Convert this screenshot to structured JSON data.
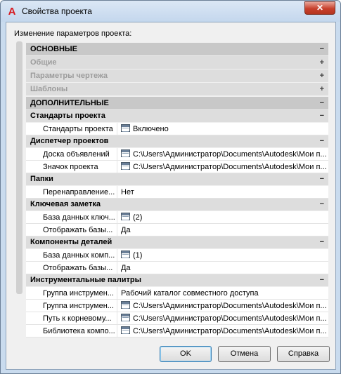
{
  "window": {
    "title": "Свойства проекта",
    "app_icon": "A",
    "close_glyph": "✕"
  },
  "subtitle": "Изменение параметров проекта:",
  "sections": {
    "basic": {
      "label": "ОСНОВНЫЕ",
      "toggle": "−"
    },
    "general": {
      "label": "Общие",
      "toggle": "+"
    },
    "drawing": {
      "label": "Параметры чертежа",
      "toggle": "+"
    },
    "templates": {
      "label": "Шаблоны",
      "toggle": "+"
    },
    "advanced": {
      "label": "ДОПОЛНИТЕЛЬНЫЕ",
      "toggle": "−"
    }
  },
  "groups": {
    "standards": {
      "label": "Стандарты проекта",
      "toggle": "−",
      "rows": [
        {
          "name": "Стандарты проекта",
          "value": "Включено",
          "icon": "table-icon"
        }
      ]
    },
    "manager": {
      "label": "Диспетчер проектов",
      "toggle": "−",
      "rows": [
        {
          "name": "Доска объявлений",
          "value": "C:\\Users\\Администратор\\Documents\\Autodesk\\Мои п...",
          "icon": "table-icon"
        },
        {
          "name": "Значок проекта",
          "value": "C:\\Users\\Администратор\\Documents\\Autodesk\\Мои п...",
          "icon": "table-icon"
        }
      ]
    },
    "folders": {
      "label": "Папки",
      "toggle": "−",
      "rows": [
        {
          "name": "Перенаправление...",
          "value": "Нет",
          "icon": ""
        }
      ]
    },
    "keynote": {
      "label": "Ключевая заметка",
      "toggle": "−",
      "rows": [
        {
          "name": "База данных ключ...",
          "value": "(2)",
          "icon": "table-icon"
        },
        {
          "name": "Отображать базы...",
          "value": "Да",
          "icon": ""
        }
      ]
    },
    "components": {
      "label": "Компоненты деталей",
      "toggle": "−",
      "rows": [
        {
          "name": "База данных комп...",
          "value": "(1)",
          "icon": "table-icon"
        },
        {
          "name": "Отображать базы...",
          "value": "Да",
          "icon": ""
        }
      ]
    },
    "palettes": {
      "label": "Инструментальные палитры",
      "toggle": "−",
      "rows": [
        {
          "name": "Группа инструмен...",
          "value": "Рабочий каталог совместного доступа",
          "icon": ""
        },
        {
          "name": "Группа инструмен...",
          "value": "C:\\Users\\Администратор\\Documents\\Autodesk\\Мои п...",
          "icon": "table-icon"
        },
        {
          "name": "Путь к корневому...",
          "value": "C:\\Users\\Администратор\\Documents\\Autodesk\\Мои п...",
          "icon": "table-icon"
        },
        {
          "name": "Библиотека компо...",
          "value": "C:\\Users\\Администратор\\Documents\\Autodesk\\Мои п...",
          "icon": "table-icon"
        }
      ]
    }
  },
  "buttons": {
    "ok": "OK",
    "cancel": "Отмена",
    "help": "Справка"
  }
}
